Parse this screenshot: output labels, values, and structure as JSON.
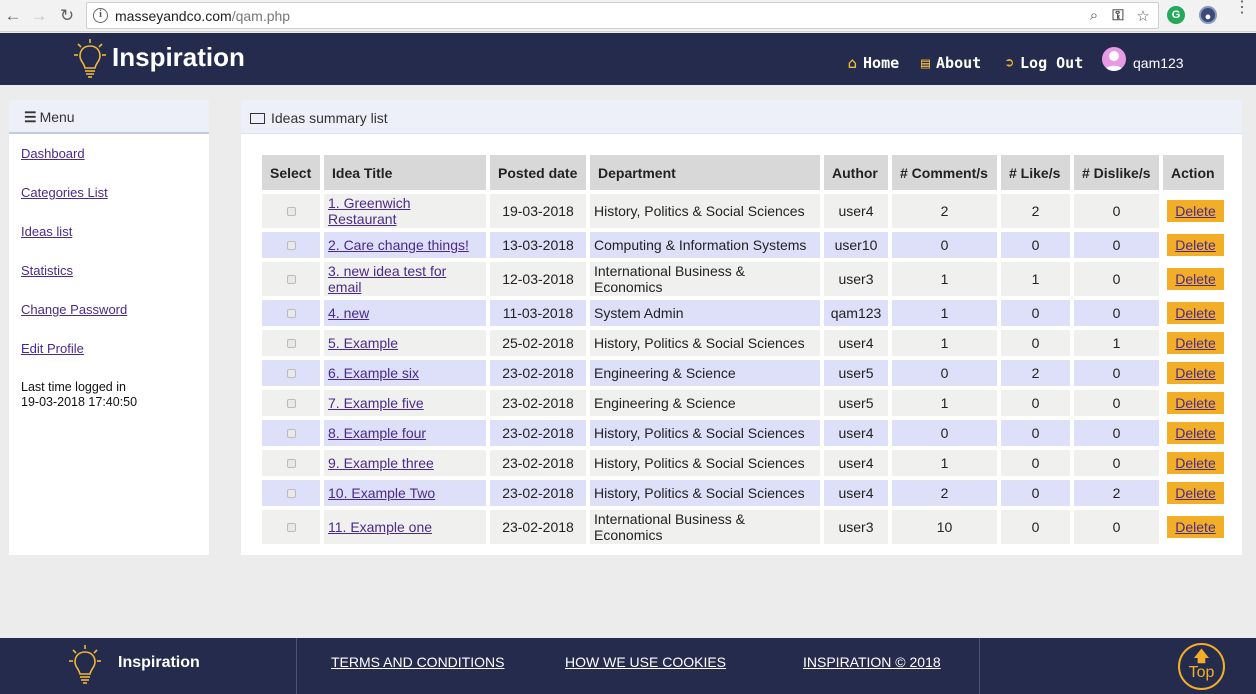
{
  "browser": {
    "url_host": "masseyandco.com",
    "url_path": "/qam.php",
    "back_icon": "arrow-left-icon",
    "forward_icon": "arrow-right-icon",
    "reload_icon": "reload-icon"
  },
  "header": {
    "brand": "Inspiration",
    "nav": [
      {
        "label": "Home",
        "icon": "home-icon"
      },
      {
        "label": "About",
        "icon": "list-icon"
      },
      {
        "label": "Log Out",
        "icon": "sign-out-icon"
      }
    ],
    "username": "qam123"
  },
  "sidebar": {
    "title": "Menu",
    "links": [
      "Dashboard",
      "Categories List",
      "Ideas list",
      "Statistics",
      "Change Password",
      "Edit Profile"
    ],
    "last_login_label": "Last time logged in",
    "last_login_value": "19-03-2018 17:40:50"
  },
  "panel": {
    "title": "Ideas summary list",
    "columns": [
      "Select",
      "Idea Title",
      "Posted date",
      "Department",
      "Author",
      "# Comment/s",
      "# Like/s",
      "# Dislike/s",
      "Action"
    ],
    "rows": [
      {
        "title": "1. Greenwich Restaurant",
        "date": "19-03-2018",
        "dept": "History, Politics & Social Sciences",
        "author": "user4",
        "comments": "2",
        "likes": "2",
        "dislikes": "0",
        "action": "Delete"
      },
      {
        "title": "2. Care change things!",
        "date": "13-03-2018",
        "dept": "Computing & Information Systems",
        "author": "user10",
        "comments": "0",
        "likes": "0",
        "dislikes": "0",
        "action": "Delete"
      },
      {
        "title": "3. new idea test for email",
        "date": "12-03-2018",
        "dept": "International Business & Economics",
        "author": "user3",
        "comments": "1",
        "likes": "1",
        "dislikes": "0",
        "action": "Delete"
      },
      {
        "title": "4. new",
        "date": "11-03-2018",
        "dept": "System Admin",
        "author": "qam123",
        "comments": "1",
        "likes": "0",
        "dislikes": "0",
        "action": "Delete"
      },
      {
        "title": "5. Example",
        "date": "25-02-2018",
        "dept": "History, Politics & Social Sciences",
        "author": "user4",
        "comments": "1",
        "likes": "0",
        "dislikes": "1",
        "action": "Delete"
      },
      {
        "title": "6. Example six",
        "date": "23-02-2018",
        "dept": "Engineering & Science",
        "author": "user5",
        "comments": "0",
        "likes": "2",
        "dislikes": "0",
        "action": "Delete"
      },
      {
        "title": "7. Example five",
        "date": "23-02-2018",
        "dept": "Engineering & Science",
        "author": "user5",
        "comments": "1",
        "likes": "0",
        "dislikes": "0",
        "action": "Delete"
      },
      {
        "title": "8. Example four",
        "date": "23-02-2018",
        "dept": "History, Politics & Social Sciences",
        "author": "user4",
        "comments": "0",
        "likes": "0",
        "dislikes": "0",
        "action": "Delete"
      },
      {
        "title": "9. Example three",
        "date": "23-02-2018",
        "dept": "History, Politics & Social Sciences",
        "author": "user4",
        "comments": "1",
        "likes": "0",
        "dislikes": "0",
        "action": "Delete"
      },
      {
        "title": "10. Example Two",
        "date": "23-02-2018",
        "dept": "History, Politics & Social Sciences",
        "author": "user4",
        "comments": "2",
        "likes": "0",
        "dislikes": "2",
        "action": "Delete"
      },
      {
        "title": "11. Example one",
        "date": "23-02-2018",
        "dept": "International Business & Economics",
        "author": "user3",
        "comments": "10",
        "likes": "0",
        "dislikes": "0",
        "action": "Delete"
      }
    ]
  },
  "footer": {
    "brand": "Inspiration",
    "links": [
      "TERMS AND CONDITIONS",
      "HOW WE USE COOKIES",
      "INSPIRATION © 2018"
    ],
    "top_label": "Top"
  },
  "colors": {
    "header_bg": "#252b4d",
    "accent": "#f3ae28",
    "link": "#4a2a8a",
    "row_alt": "#dee0fa"
  }
}
